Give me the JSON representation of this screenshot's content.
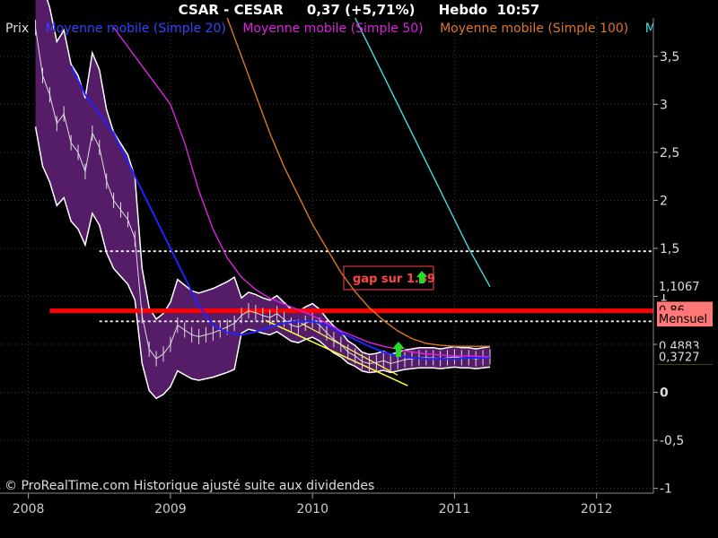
{
  "header": {
    "symbol": "CSAR - CESAR",
    "price": "0,37 (+5,71%)",
    "period": "Hebdo",
    "time": "10:57"
  },
  "legend": [
    {
      "label": "Prix",
      "color": "#dddddd"
    },
    {
      "label": "Moyenne mobile (Simple 20)",
      "color": "#2222ff"
    },
    {
      "label": "Moyenne mobile (Simple 50)",
      "color": "#dd22dd"
    },
    {
      "label": "Moyenne mobile (Simple 100)",
      "color": "#dd7722"
    },
    {
      "label": "Moye",
      "color": "#44dddd"
    }
  ],
  "footer": "© ProRealTime.com Historique ajusté suite aux dividendes",
  "annotation": "gap sur 1.89",
  "price_labels": [
    {
      "text": "1,1067",
      "bg": "#000000",
      "fg": "#dddddd",
      "value": 1.1067
    },
    {
      "text": "0,86",
      "bg": "#ff7777",
      "fg": "#000000",
      "value": 0.86
    },
    {
      "text": "Mensuel",
      "bg": "#ff7777",
      "fg": "#000000",
      "value": 0.77
    },
    {
      "text": "0,4883",
      "bg": "#000000",
      "fg": "#dddddd",
      "value": 0.4883
    },
    {
      "text": "0,37",
      "bg": "#ffcc00",
      "fg": "#000000",
      "value": 0.37
    },
    {
      "text": "0,3727",
      "bg": "#000000",
      "fg": "#dddddd",
      "value": 0.3727
    }
  ],
  "chart_data": {
    "type": "line",
    "title": "CSAR - CESAR 0,37 (+5,71%) Hebdo 10:57",
    "xlabel": "",
    "ylabel": "",
    "xlim": [
      2007.8,
      2012.4
    ],
    "ylim": [
      -1.05,
      3.9
    ],
    "x_ticks": [
      "2008",
      "2009",
      "2010",
      "2011",
      "2012"
    ],
    "x_tick_values": [
      2008.0,
      2009.0,
      2010.0,
      2011.0,
      2012.0
    ],
    "y_ticks": [
      "3,5",
      "3",
      "2,5",
      "2",
      "1,5",
      "1",
      "0,5",
      "0",
      "-0,5",
      "-1"
    ],
    "y_tick_values": [
      3.5,
      3.0,
      2.5,
      2.0,
      1.5,
      1.0,
      0.5,
      0.0,
      -0.5,
      -1.0
    ],
    "grid": true,
    "legend_position": "top-left",
    "horizontal_lines": [
      {
        "name": "gap-level",
        "value": 1.47,
        "style": "dotted",
        "color": "#ffffff"
      },
      {
        "name": "resistance",
        "value": 0.85,
        "style": "solid",
        "color": "#ff0000"
      },
      {
        "name": "support-level",
        "value": 0.74,
        "style": "dotted",
        "color": "#ffffff"
      }
    ],
    "series": [
      {
        "name": "Prix",
        "color": "#dddddd",
        "x": [
          2008.05,
          2008.1,
          2008.15,
          2008.2,
          2008.25,
          2008.3,
          2008.35,
          2008.4,
          2008.45,
          2008.5,
          2008.55,
          2008.6,
          2008.65,
          2008.7,
          2008.75,
          2008.8,
          2008.85,
          2008.9,
          2008.95,
          2009.0,
          2009.05,
          2009.1,
          2009.15,
          2009.2,
          2009.25,
          2009.3,
          2009.35,
          2009.4,
          2009.45,
          2009.5,
          2009.55,
          2009.6,
          2009.65,
          2009.7,
          2009.75,
          2009.8,
          2009.85,
          2009.9,
          2009.95,
          2010.0,
          2010.05,
          2010.1,
          2010.15,
          2010.2,
          2010.25,
          2010.3,
          2010.35,
          2010.4,
          2010.45,
          2010.5,
          2010.55,
          2010.6,
          2010.65,
          2010.7,
          2010.75,
          2010.8,
          2010.85,
          2010.9,
          2010.95,
          2011.0,
          2011.05,
          2011.1,
          2011.15,
          2011.2,
          2011.25
        ],
        "values": [
          3.8,
          3.3,
          3.1,
          2.8,
          2.9,
          2.6,
          2.5,
          2.3,
          2.7,
          2.55,
          2.2,
          2.0,
          1.9,
          1.8,
          1.6,
          0.8,
          0.45,
          0.35,
          0.4,
          0.5,
          0.7,
          0.65,
          0.6,
          0.58,
          0.6,
          0.62,
          0.65,
          0.68,
          0.72,
          0.8,
          0.85,
          0.83,
          0.8,
          0.78,
          0.82,
          0.76,
          0.7,
          0.68,
          0.72,
          0.75,
          0.7,
          0.62,
          0.55,
          0.5,
          0.42,
          0.38,
          0.32,
          0.3,
          0.31,
          0.33,
          0.3,
          0.32,
          0.34,
          0.35,
          0.36,
          0.36,
          0.36,
          0.35,
          0.36,
          0.37,
          0.36,
          0.36,
          0.35,
          0.36,
          0.37
        ]
      },
      {
        "name": "Moyenne mobile (Simple 20)",
        "color": "#2222ff",
        "x": [
          2008.3,
          2008.4,
          2008.5,
          2008.6,
          2008.7,
          2008.8,
          2008.9,
          2009.0,
          2009.1,
          2009.2,
          2009.3,
          2009.4,
          2009.5,
          2009.6,
          2009.7,
          2009.8,
          2009.9,
          2010.0,
          2010.1,
          2010.2,
          2010.3,
          2010.4,
          2010.5,
          2010.6,
          2010.7,
          2010.8,
          2010.9,
          2011.0,
          2011.1,
          2011.2,
          2011.25
        ],
        "values": [
          3.4,
          3.1,
          2.9,
          2.7,
          2.4,
          2.1,
          1.8,
          1.5,
          1.2,
          0.9,
          0.7,
          0.62,
          0.6,
          0.63,
          0.68,
          0.72,
          0.74,
          0.74,
          0.7,
          0.62,
          0.55,
          0.48,
          0.42,
          0.38,
          0.36,
          0.35,
          0.35,
          0.35,
          0.36,
          0.36,
          0.36
        ]
      },
      {
        "name": "Moyenne mobile (Simple 50)",
        "color": "#dd22dd",
        "x": [
          2008.6,
          2008.7,
          2008.8,
          2008.9,
          2009.0,
          2009.1,
          2009.2,
          2009.3,
          2009.4,
          2009.5,
          2009.6,
          2009.7,
          2009.8,
          2009.9,
          2010.0,
          2010.1,
          2010.2,
          2010.3,
          2010.4,
          2010.5,
          2010.6,
          2010.7,
          2010.8,
          2010.9,
          2011.0,
          2011.1,
          2011.25
        ],
        "values": [
          3.8,
          3.6,
          3.4,
          3.2,
          3.0,
          2.6,
          2.1,
          1.7,
          1.4,
          1.2,
          1.07,
          0.98,
          0.92,
          0.86,
          0.8,
          0.72,
          0.64,
          0.58,
          0.52,
          0.48,
          0.45,
          0.42,
          0.4,
          0.39,
          0.38,
          0.38,
          0.37
        ]
      },
      {
        "name": "Moyenne mobile (Simple 100)",
        "color": "#dd7722",
        "x": [
          2009.4,
          2009.5,
          2009.6,
          2009.7,
          2009.8,
          2009.9,
          2010.0,
          2010.1,
          2010.2,
          2010.3,
          2010.4,
          2010.5,
          2010.6,
          2010.7,
          2010.8,
          2010.9,
          2011.0,
          2011.1,
          2011.25
        ],
        "values": [
          3.9,
          3.5,
          3.1,
          2.7,
          2.35,
          2.05,
          1.75,
          1.5,
          1.25,
          1.05,
          0.88,
          0.75,
          0.64,
          0.56,
          0.51,
          0.49,
          0.48,
          0.48,
          0.48
        ]
      },
      {
        "name": "Moye",
        "color": "#44dddd",
        "x": [
          2010.3,
          2010.4,
          2010.5,
          2010.6,
          2010.7,
          2010.8,
          2010.9,
          2011.0,
          2011.1,
          2011.25
        ],
        "values": [
          3.9,
          3.6,
          3.3,
          3.0,
          2.7,
          2.4,
          2.1,
          1.8,
          1.5,
          1.1
        ]
      }
    ]
  }
}
